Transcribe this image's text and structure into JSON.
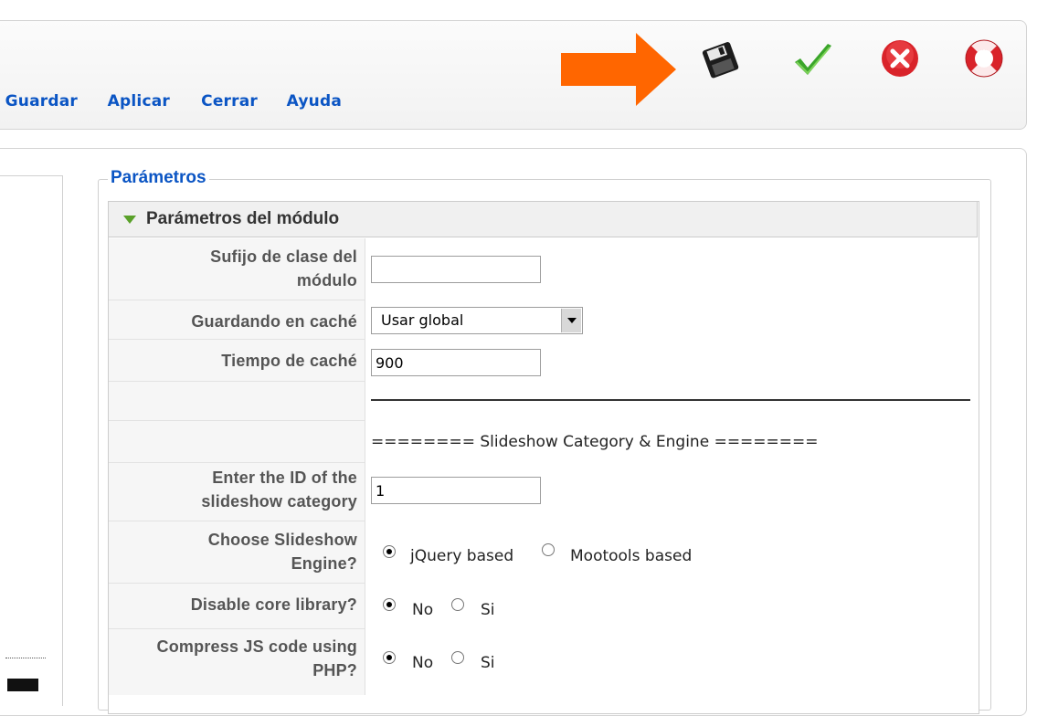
{
  "toolbar": {
    "buttons": [
      {
        "label": "Guardar",
        "icon": "floppy-disk-icon"
      },
      {
        "label": "Aplicar",
        "icon": "checkmark-icon"
      },
      {
        "label": "Cerrar",
        "icon": "close-circle-icon"
      },
      {
        "label": "Ayuda",
        "icon": "lifebuoy-icon"
      }
    ],
    "arrow_color": "#ff6600"
  },
  "params": {
    "legend": "Parámetros",
    "panel_title": "Parámetros del módulo",
    "fields": {
      "suffix_label": "Sufijo de clase del módulo",
      "suffix_value": "",
      "cache_label": "Guardando en caché",
      "cache_value": "Usar global",
      "cache_time_label": "Tiempo de caché",
      "cache_time_value": "900",
      "section_title": "======== Slideshow Category & Engine ========",
      "category_label": "Enter the ID of the slideshow category",
      "category_value": "1",
      "engine_label": "Choose Slideshow Engine?",
      "engine_options": [
        "jQuery based",
        "Mootools based"
      ],
      "engine_selected": "jQuery based",
      "core_label": "Disable core library?",
      "core_options": [
        "No",
        "Si"
      ],
      "core_selected": "No",
      "compress_label": "Compress JS code using PHP?",
      "compress_options": [
        "No",
        "Si"
      ],
      "compress_selected": "No"
    }
  }
}
